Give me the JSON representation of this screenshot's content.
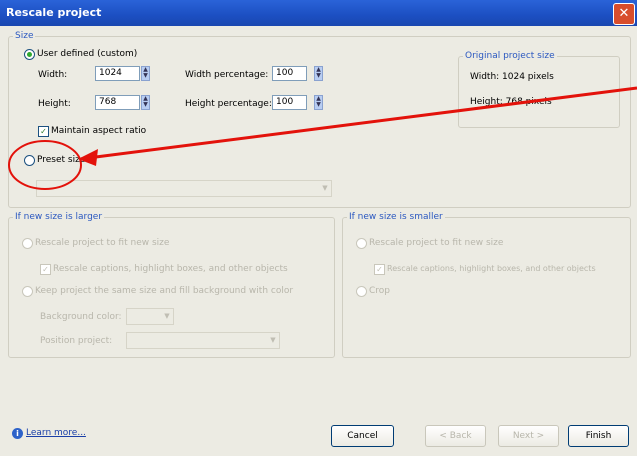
{
  "window": {
    "title": "Rescale project",
    "close_glyph": "✕"
  },
  "size": {
    "legend": "Size",
    "user_defined_label": "User defined (custom)",
    "width_label": "Width:",
    "width_value": "1024",
    "height_label": "Height:",
    "height_value": "768",
    "width_pct_label": "Width percentage:",
    "width_pct_value": "100",
    "height_pct_label": "Height percentage:",
    "height_pct_value": "100",
    "maintain_aspect_label": "Maintain aspect ratio",
    "preset_label": "Preset size",
    "preset_value": ""
  },
  "original": {
    "legend": "Original project size",
    "width_text": "Width: 1024 pixels",
    "height_text": "Height: 768 pixels"
  },
  "larger": {
    "legend": "If new size is larger",
    "rescale_fit_label": "Rescale project to fit new size",
    "rescale_captions_label": "Rescale captions, highlight boxes, and other objects",
    "keep_same_label": "Keep project the same size and fill background with color",
    "bg_color_label": "Background color:",
    "position_label": "Position project:"
  },
  "smaller": {
    "legend": "If new size is smaller",
    "rescale_fit_label": "Rescale project to fit new size",
    "rescale_captions_label": "Rescale captions, highlight boxes, and other objects",
    "crop_label": "Crop"
  },
  "footer": {
    "learn_more": "Learn more...",
    "cancel": "Cancel",
    "back": "< Back",
    "next": "Next >",
    "finish": "Finish"
  },
  "annotation": {
    "arrow_color": "#e3120b",
    "circle_color": "#e3120b"
  }
}
